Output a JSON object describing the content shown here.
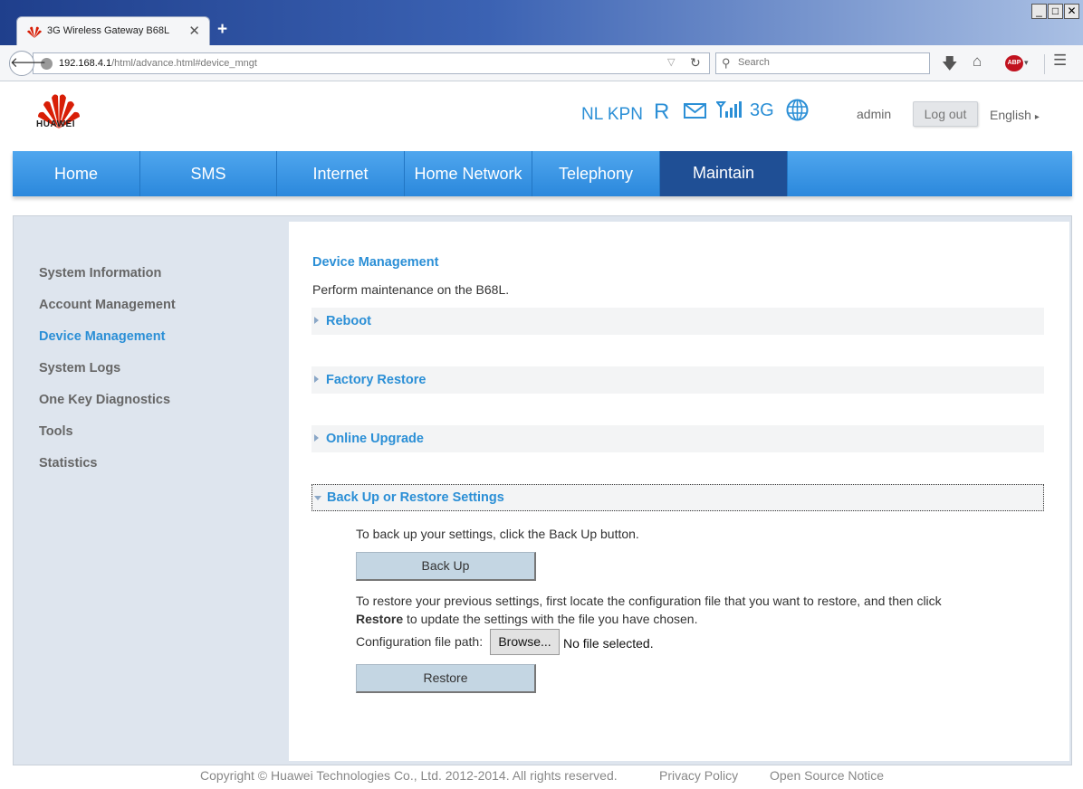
{
  "browser": {
    "tab_title": "3G Wireless Gateway B68L",
    "tab_close": "✕",
    "new_tab": "+",
    "url_host": "192.168.4.1",
    "url_path": "/html/advance.html#device_mngt",
    "search_placeholder": "Search",
    "window_buttons": [
      "_",
      "□",
      "✕"
    ]
  },
  "header": {
    "logo_text": "HUAWEI",
    "operator": "NL KPN",
    "roaming": "R",
    "network_type": "3G",
    "user": "admin",
    "logout_label": "Log out",
    "language": "English"
  },
  "nav": {
    "items": [
      "Home",
      "SMS",
      "Internet",
      "Home Network",
      "Telephony",
      "Maintain"
    ],
    "active": "Maintain"
  },
  "sidebar": {
    "items": [
      "System Information",
      "Account Management",
      "Device Management",
      "System Logs",
      "One Key Diagnostics",
      "Tools",
      "Statistics"
    ],
    "active": "Device Management"
  },
  "panel": {
    "title": "Device Management",
    "description": "Perform maintenance on the B68L.",
    "sections": [
      "Reboot",
      "Factory Restore",
      "Online Upgrade",
      "Back Up or Restore Settings"
    ],
    "backup_text": "To back up your settings, click the Back Up button.",
    "backup_button": "Back Up",
    "restore_text_1": "To restore your previous settings, first locate the configuration file that you want to restore, and then click",
    "restore_bold": "Restore",
    "restore_text_2": "to update the settings with the file you have chosen.",
    "file_path_label": "Configuration file path:",
    "browse_button": "Browse...",
    "file_status": "No file selected.",
    "restore_button": "Restore"
  },
  "footer": {
    "copyright": "Copyright © Huawei Technologies Co., Ltd. 2012-2014. All rights reserved.",
    "privacy": "Privacy Policy",
    "open_source": "Open Source Notice"
  },
  "colors": {
    "accent_blue": "#2b8fd6",
    "nav_active": "#1f4f95",
    "huawei_red": "#d81e06"
  }
}
